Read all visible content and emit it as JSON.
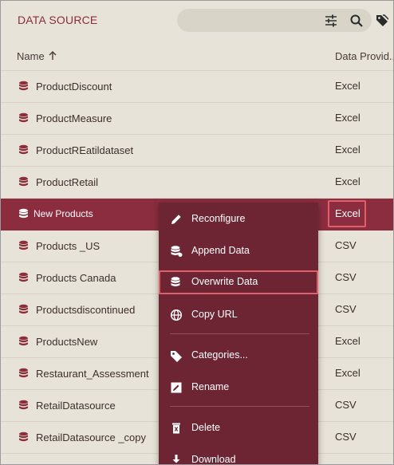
{
  "header": {
    "title": "DATA SOURCE",
    "filter_icon": "sliders-icon",
    "search_icon": "search-icon",
    "tag_icon": "tag-icon"
  },
  "columns": {
    "name": "Name",
    "provider": "Data Provid..."
  },
  "rows": [
    {
      "name": "ProductDiscount",
      "provider": "Excel"
    },
    {
      "name": "ProductMeasure",
      "provider": "Excel"
    },
    {
      "name": "ProductREatildataset",
      "provider": "Excel"
    },
    {
      "name": "ProductRetail",
      "provider": "Excel"
    },
    {
      "name": "New Products",
      "provider": "Excel",
      "selected": true
    },
    {
      "name": "Products _US",
      "provider": "CSV"
    },
    {
      "name": "Products Canada",
      "provider": "CSV"
    },
    {
      "name": "Productsdiscontinued",
      "provider": "CSV"
    },
    {
      "name": "ProductsNew",
      "provider": "Excel"
    },
    {
      "name": "Restaurant_Assessment",
      "provider": "Excel"
    },
    {
      "name": "RetailDatasource",
      "provider": "CSV"
    },
    {
      "name": "RetailDatasource _copy",
      "provider": "CSV"
    }
  ],
  "context_menu": {
    "items": [
      {
        "label": "Reconfigure",
        "icon": "pencil-icon"
      },
      {
        "label": "Append Data",
        "icon": "database-plus-icon"
      },
      {
        "label": "Overwrite Data",
        "icon": "database-refresh-icon",
        "highlighted": true
      },
      {
        "label": "Copy URL",
        "icon": "globe-icon"
      },
      {
        "label": "Categories...",
        "icon": "tag-icon"
      },
      {
        "label": "Rename",
        "icon": "rename-icon"
      },
      {
        "label": "Delete",
        "icon": "trash-icon"
      },
      {
        "label": "Download",
        "icon": "download-icon"
      }
    ]
  },
  "colors": {
    "accent": "#8b2d3f",
    "menu_bg": "#6e2533",
    "highlight_border": "#e0606a",
    "page_bg": "#e7e3d8"
  }
}
